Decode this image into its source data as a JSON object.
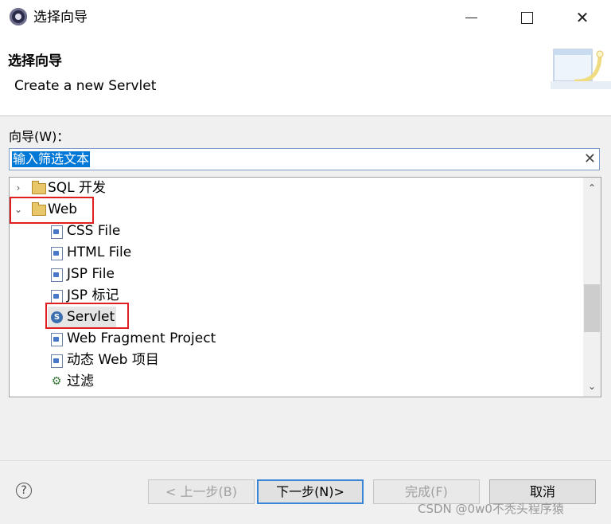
{
  "window": {
    "title": "选择向导",
    "icon": "eclipse-app-icon"
  },
  "banner": {
    "title": "选择向导",
    "description": "Create a new Servlet"
  },
  "filter": {
    "label": "向导(W)：",
    "value": "输入筛选文本",
    "clear_icon": "✕"
  },
  "tree": {
    "items": [
      {
        "label": "SQL 开发",
        "type": "folder",
        "expanded": false,
        "twisty": "›"
      },
      {
        "label": "Web",
        "type": "folder",
        "expanded": true,
        "twisty": "⌄"
      },
      {
        "label": "CSS File",
        "type": "file"
      },
      {
        "label": "HTML File",
        "type": "file"
      },
      {
        "label": "JSP File",
        "type": "file"
      },
      {
        "label": "JSP 标记",
        "type": "file"
      },
      {
        "label": "Servlet",
        "type": "servlet",
        "selected": true
      },
      {
        "label": "Web Fragment Project",
        "type": "file"
      },
      {
        "label": "动态 Web 项目",
        "type": "file"
      },
      {
        "label": "过滤",
        "type": "filter"
      }
    ],
    "scroll_up": "⌃",
    "scroll_down": "⌄"
  },
  "buttons": {
    "back": "< 上一步(B)",
    "next": "下一步(N)>",
    "finish": "完成(F)",
    "cancel": "取消"
  },
  "help": "?",
  "watermark": "CSDN @0w0不秃头程序猿",
  "colors": {
    "highlight": "#0078d7",
    "annotation_red": "#e02020"
  }
}
